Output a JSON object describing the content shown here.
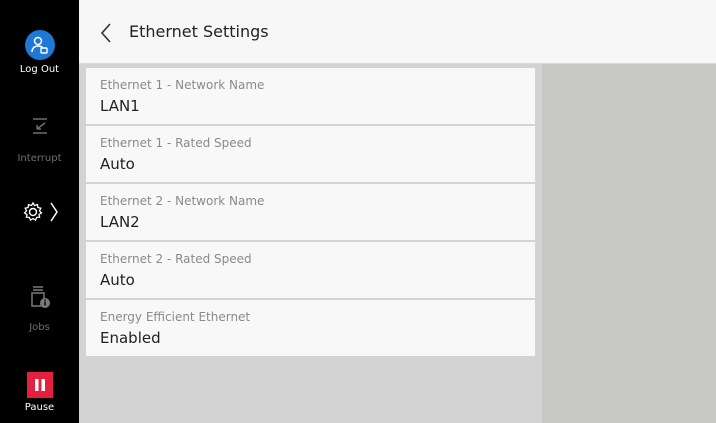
{
  "header": {
    "title": "Ethernet Settings"
  },
  "rail": {
    "logout_label": "Log Out",
    "interrupt_label": "Interrupt",
    "jobs_label": "Jobs",
    "pause_label": "Pause"
  },
  "settings": [
    {
      "label": "Ethernet 1 - Network Name",
      "value": "LAN1"
    },
    {
      "label": "Ethernet 1 - Rated Speed",
      "value": "Auto"
    },
    {
      "label": "Ethernet 2 - Network Name",
      "value": "LAN2"
    },
    {
      "label": "Ethernet 2 - Rated Speed",
      "value": "Auto"
    },
    {
      "label": "Energy Efficient Ethernet",
      "value": "Enabled"
    }
  ],
  "colors": {
    "accent_blue": "#1e78d6",
    "pause_red": "#e3203f",
    "rail_bg": "#000000"
  },
  "icons": {
    "logout": "user-logout-icon",
    "interrupt": "interrupt-icon",
    "settings": "gear-icon",
    "jobs": "jobs-icon",
    "pause": "pause-icon",
    "back": "chevron-left-icon"
  }
}
